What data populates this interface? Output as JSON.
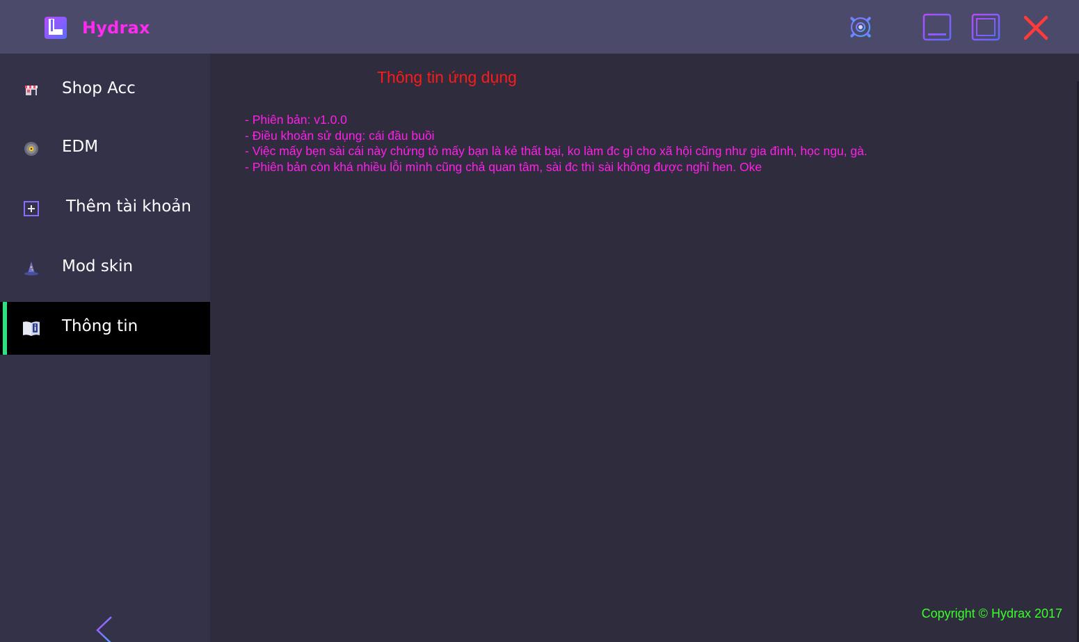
{
  "app": {
    "name": "Hydrax",
    "logo_icon": "app-logo-icon",
    "accent_color": "#ff2bf1"
  },
  "titlebar": {
    "buttons": [
      {
        "name": "settings",
        "icon": "gear-icon"
      },
      {
        "name": "minimize",
        "icon": "minimize-icon"
      },
      {
        "name": "maximize",
        "icon": "maximize-icon"
      },
      {
        "name": "close",
        "icon": "close-icon"
      }
    ]
  },
  "sidebar": {
    "items": [
      {
        "label": "Shop Acc",
        "icon": "shop-icon",
        "active": false
      },
      {
        "label": "EDM",
        "icon": "music-disc-icon",
        "active": false
      },
      {
        "label": "Thêm tài khoản",
        "icon": "add-account-icon",
        "active": false
      },
      {
        "label": "Mod skin",
        "icon": "wizard-hat-icon",
        "active": false
      },
      {
        "label": "Thông tin",
        "icon": "info-book-icon",
        "active": true
      }
    ],
    "active_color": "#2ee07f",
    "collapse_icon": "chevron-left-icon"
  },
  "main": {
    "title": "Thông tin ứng dụng",
    "lines": [
      "- Phiên bản: v1.0.0",
      "- Điều khoản sử dụng: cái đầu buồi",
      "- Việc mấy bẹn sài cái này chứng tỏ mấy bạn là kẻ thất bại, ko làm đc gì cho xã hội cũng như gia đình, học ngu, gà.",
      "- Phiên bản còn khá nhiều lỗi mình cũng chả quan tâm, sài đc thì sài không được nghỉ hen. Oke"
    ],
    "copyright": "Copyright © Hydrax 2017"
  }
}
